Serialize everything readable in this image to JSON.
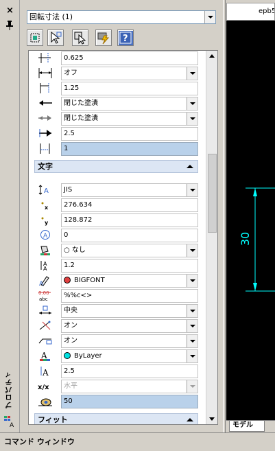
{
  "palette": {
    "title": "プロパティ",
    "object_type": "回転寸法 (1)"
  },
  "toolbar": {
    "buttons": [
      "toggle-pickadd-icon",
      "select-objects-icon",
      "quick-select-icon",
      "quick-properties-icon",
      "help-icon"
    ],
    "help_glyph": "?"
  },
  "rows_top": [
    {
      "icon": "dimline-ext-icon",
      "value": "0.625",
      "dropdown": false
    },
    {
      "icon": "dimline-icon",
      "value": "オフ",
      "dropdown": true
    },
    {
      "icon": "ext-line-offset-icon",
      "value": "1.25",
      "dropdown": false
    },
    {
      "icon": "arrow1-icon",
      "value": "閉じた塗潰",
      "dropdown": true
    },
    {
      "icon": "arrow2-icon",
      "value": "閉じた塗潰",
      "dropdown": true
    },
    {
      "icon": "arrow-size-icon",
      "value": "2.5",
      "dropdown": false
    },
    {
      "icon": "ext-line-ext-icon",
      "value": "1",
      "dropdown": false,
      "selected": true
    }
  ],
  "section_text": "文字",
  "rows_text": [
    {
      "icon": "text-style-icon",
      "value": "JIS",
      "dropdown": true
    },
    {
      "icon": "text-pos-x-icon",
      "value": "276.634",
      "dropdown": false
    },
    {
      "icon": "text-pos-y-icon",
      "value": "128.872",
      "dropdown": false
    },
    {
      "icon": "text-rotation-icon",
      "value": "0",
      "dropdown": false
    },
    {
      "icon": "fill-color-icon",
      "value": "○ なし",
      "dropdown": true
    },
    {
      "icon": "text-height-icon",
      "value": "1.2",
      "dropdown": false
    },
    {
      "icon": "text-font-icon",
      "value": "BIGFONT",
      "dropdown": true,
      "swatch": "#e04040"
    },
    {
      "icon": "text-override-icon",
      "value": "%%c<>",
      "dropdown": false
    },
    {
      "icon": "text-justify-icon",
      "value": "中央",
      "dropdown": true
    },
    {
      "icon": "text-inside-icon",
      "value": "オン",
      "dropdown": true
    },
    {
      "icon": "text-leader-icon",
      "value": "オン",
      "dropdown": true
    },
    {
      "icon": "text-color-icon",
      "value": "ByLayer",
      "dropdown": true,
      "swatch": "#00e0e0"
    },
    {
      "icon": "text-size-icon",
      "value": "2.5",
      "dropdown": false
    },
    {
      "icon": "fraction-format-icon",
      "value": "水平",
      "dropdown": true,
      "disabled": true
    },
    {
      "icon": "measurement-icon",
      "value": "50",
      "dropdown": false,
      "selected": true
    }
  ],
  "icon_labels": {
    "fraction": "x/x",
    "override_top": "0.00",
    "override_bottom": "abc",
    "pos_x": "x",
    "pos_y": "y",
    "size_a": "A"
  },
  "section_next": "フィット",
  "drawing": {
    "doc_tab": "epb5",
    "dim_text": "30",
    "model_tab": "モデル"
  },
  "command_window": "コマンド ウィンドウ",
  "colors": {
    "panel_bg": "#d4d0c8",
    "section_bg": "#dce6f4",
    "selected_bg": "#b9d1ea",
    "canvas_bg": "#000000",
    "dim_color": "#00ffff"
  }
}
